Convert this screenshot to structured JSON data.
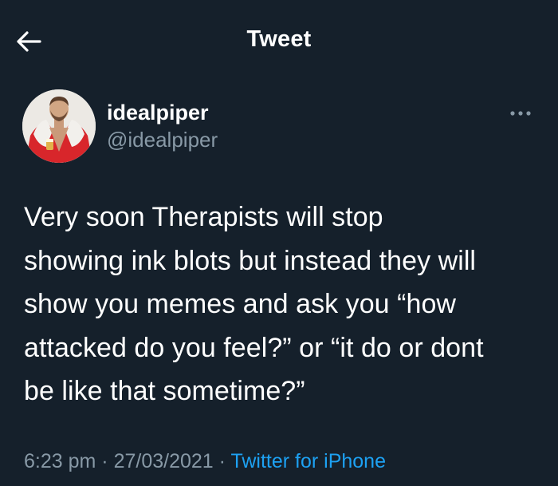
{
  "header": {
    "title": "Tweet",
    "back_icon": "arrow-left-icon"
  },
  "author": {
    "display_name": "idealpiper",
    "handle": "@idealpiper",
    "avatar_icon": "profile-photo"
  },
  "more_icon": "more-horizontal-icon",
  "tweet": {
    "text": "Very soon Therapists will stop\nshowing ink blots but instead they will\nshow you memes and ask you “how\nattacked do you feel?” or “it do or dont\nbe like that sometime?”"
  },
  "meta": {
    "time": "6:23 pm",
    "separator_1": " · ",
    "date": "27/03/2021",
    "separator_2": " · ",
    "source": "Twitter for iPhone"
  },
  "colors": {
    "background": "#15202b",
    "text_primary": "#ffffff",
    "text_secondary": "#8899a6",
    "link": "#1da1f2"
  }
}
